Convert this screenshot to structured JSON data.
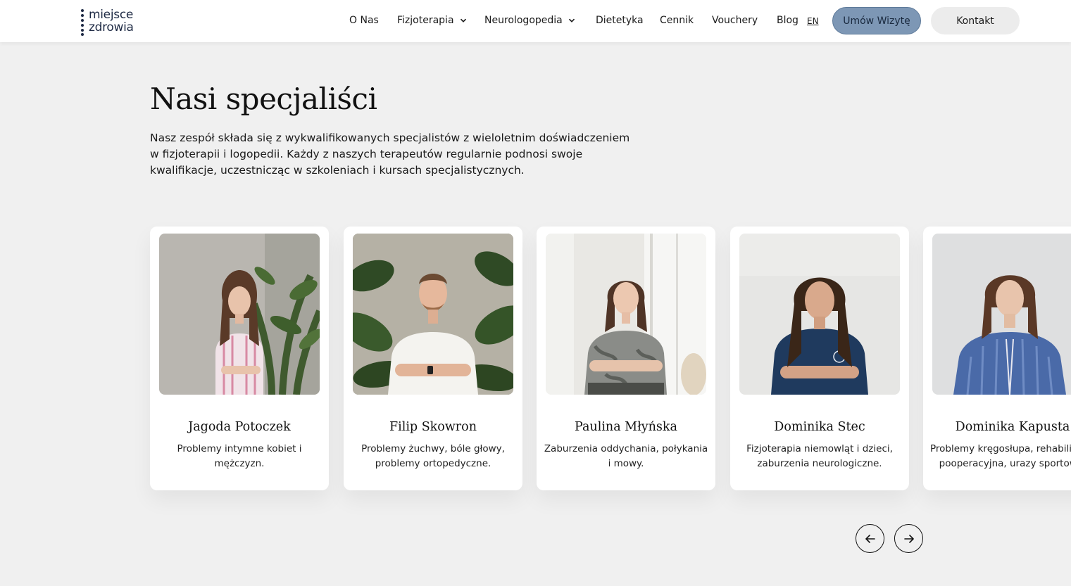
{
  "header": {
    "logo": {
      "line1": "miejsce",
      "line2": "zdrowia"
    },
    "nav": [
      {
        "label": "O Nas"
      },
      {
        "label": "Fizjoterapia"
      },
      {
        "label": "Neurologopedia"
      },
      {
        "label": "Dietetyka"
      },
      {
        "label": "Cennik"
      },
      {
        "label": "Vouchery"
      },
      {
        "label": "Blog"
      }
    ],
    "lang": "EN",
    "cta_primary": "Umów Wizytę",
    "cta_secondary": "Kontakt"
  },
  "section": {
    "title": "Nasi specjaliści",
    "lead": "Nasz zespół składa się z wykwalifikowanych specjalistów z wieloletnim doświadczeniem w fizjoterapii i logopedii. Każdy z naszych terapeutów regularnie podnosi swoje kwalifikacje, uczestnicząc w szkoleniach i kursach specjalistycznych."
  },
  "specialists": [
    {
      "name": "Jagoda Potoczek",
      "desc": "Problemy intymne kobiet i mężczyzn."
    },
    {
      "name": "Filip Skowron",
      "desc": "Problemy żuchwy, bóle głowy, problemy ortopedyczne."
    },
    {
      "name": "Paulina Młyńska",
      "desc": "Zaburzenia oddychania, połykania i mowy."
    },
    {
      "name": "Dominika Stec",
      "desc": "Fizjoterapia niemowląt i dzieci, zaburzenia neurologiczne."
    },
    {
      "name": "Dominika Kapusta",
      "desc": "Problemy kręgosłupa, rehabilitacja pooperacyjna, urazy sportowe."
    }
  ],
  "colors": {
    "brand_navy": "#1e2a44",
    "cta_primary_bg": "#7d97b5",
    "page_bg": "#f0f0f0"
  },
  "icons": {
    "prev": "arrow-left-icon",
    "next": "arrow-right-icon",
    "dropdown": "chevron-down-icon"
  }
}
